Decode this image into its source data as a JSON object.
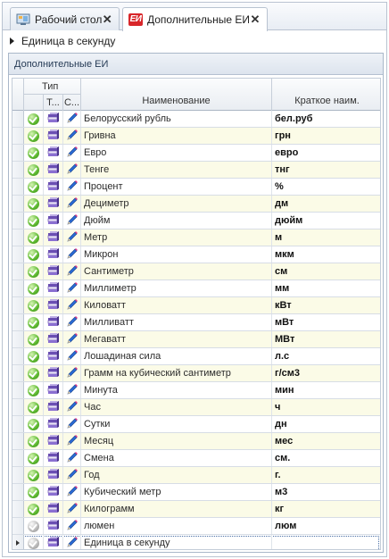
{
  "tabs": [
    {
      "label": "Рабочий стол",
      "icon": "desktop-icon"
    },
    {
      "label": "Дополнительные ЕИ",
      "icon": "ei-logo-icon",
      "logo_text": "EИ"
    }
  ],
  "breadcrumb": "Единица в секунду",
  "panel_title": "Дополнительные ЕИ",
  "grid": {
    "band_type": "Тип",
    "col_type1": "Т...",
    "col_type2": "С...",
    "col_name": "Наименование",
    "col_short": "Краткое наим.",
    "rows": [
      {
        "name": "Белорусский рубль",
        "short": "бел.руб",
        "active": true
      },
      {
        "name": "Гривна",
        "short": "грн",
        "active": true
      },
      {
        "name": "Евро",
        "short": "евро",
        "active": true
      },
      {
        "name": "Тенге",
        "short": "тнг",
        "active": true
      },
      {
        "name": "Процент",
        "short": "%",
        "active": true
      },
      {
        "name": "Дециметр",
        "short": "дм",
        "active": true
      },
      {
        "name": "Дюйм",
        "short": "дюйм",
        "active": true
      },
      {
        "name": "Метр",
        "short": "м",
        "active": true
      },
      {
        "name": "Микрон",
        "short": "мкм",
        "active": true
      },
      {
        "name": "Сантиметр",
        "short": "см",
        "active": true
      },
      {
        "name": "Миллиметр",
        "short": "мм",
        "active": true
      },
      {
        "name": "Киловатт",
        "short": "кВт",
        "active": true
      },
      {
        "name": "Милливатт",
        "short": "мВт",
        "active": true
      },
      {
        "name": "Мегаватт",
        "short": "МВт",
        "active": true
      },
      {
        "name": "Лошадиная сила",
        "short": "л.с",
        "active": true
      },
      {
        "name": "Грамм на кубический сантиметр",
        "short": "г/см3",
        "active": true
      },
      {
        "name": "Минута",
        "short": "мин",
        "active": true
      },
      {
        "name": "Час",
        "short": "ч",
        "active": true
      },
      {
        "name": "Сутки",
        "short": "дн",
        "active": true
      },
      {
        "name": "Месяц",
        "short": "мес",
        "active": true
      },
      {
        "name": "Смена",
        "short": "см.",
        "active": true
      },
      {
        "name": "Год",
        "short": "г.",
        "active": true
      },
      {
        "name": "Кубический метр",
        "short": "м3",
        "active": true
      },
      {
        "name": "Килограмм",
        "short": "кг",
        "active": true
      },
      {
        "name": "люмен",
        "short": "люм",
        "active": false
      },
      {
        "name": "Единица в секунду",
        "short": "",
        "active": false,
        "selected": true
      }
    ]
  },
  "colors": {
    "alt_row": "#fbfbe7",
    "active_status": "#5cb82e",
    "inactive_status": "#b8b8b8",
    "logo": "#d8262a"
  }
}
